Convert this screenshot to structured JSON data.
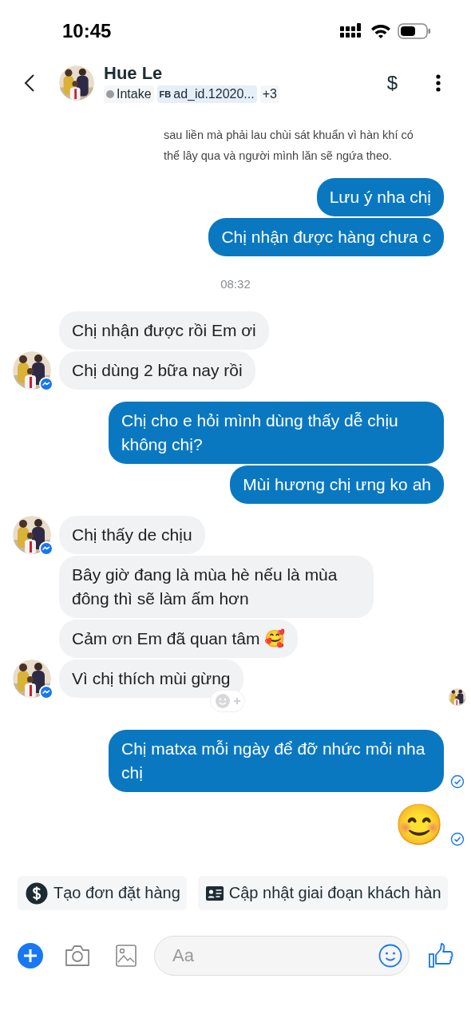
{
  "status_bar": {
    "time": "10:45"
  },
  "header": {
    "name": "Hue Le",
    "stage": {
      "label": "Intake",
      "color": "#9a9ca0"
    },
    "source_tag": {
      "prefix": "FB",
      "label": "ad_id.12020..."
    },
    "more_tags": "+3",
    "action": "$"
  },
  "messages": [
    {
      "kind": "note",
      "text": "sau liền mà phải lau chùi sát khuẩn vì hàn khí có thể lây qua và người mình lăn sẽ ngứa theo."
    },
    {
      "kind": "outgoing",
      "text": "Lưu ý nha chị"
    },
    {
      "kind": "outgoing",
      "text": "Chị nhận được hàng chưa c"
    },
    {
      "kind": "time",
      "text": "08:32"
    },
    {
      "kind": "incoming",
      "text": "Chị nhận được rồi Em ơi",
      "avatar": false
    },
    {
      "kind": "incoming",
      "text": "Chị dùng 2 bữa nay rồi",
      "avatar": true
    },
    {
      "kind": "outgoing",
      "text": "Chị cho e hỏi mình dùng thấy dễ chịu không chị?"
    },
    {
      "kind": "outgoing",
      "text": "Mùi hương chị ưng ko ah"
    },
    {
      "kind": "incoming",
      "text": "Chị thấy de chịu",
      "avatar": true
    },
    {
      "kind": "incoming",
      "text": "Bây giờ đang là mùa hè nếu là mùa đông thì sẽ làm ấm hơn",
      "avatar": false
    },
    {
      "kind": "incoming",
      "text": "Cảm ơn Em đã quan tâm 🥰",
      "avatar": false
    },
    {
      "kind": "incoming",
      "text": "Vì chị thích mùi gừng",
      "avatar": true,
      "reaction_button": true,
      "seen_by": true
    },
    {
      "kind": "outgoing",
      "text": "Chị matxa mỗi ngày để đỡ nhức mỏi nha chị",
      "delivered": true
    },
    {
      "kind": "emoji",
      "text": "😊",
      "delivered": true
    }
  ],
  "quick_actions": [
    {
      "kind": "order",
      "label": "Tạo đơn đặt hàng"
    },
    {
      "kind": "stage",
      "label": "Cập nhật giai đoạn khách hàn"
    }
  ],
  "composer": {
    "placeholder": "Aa"
  }
}
